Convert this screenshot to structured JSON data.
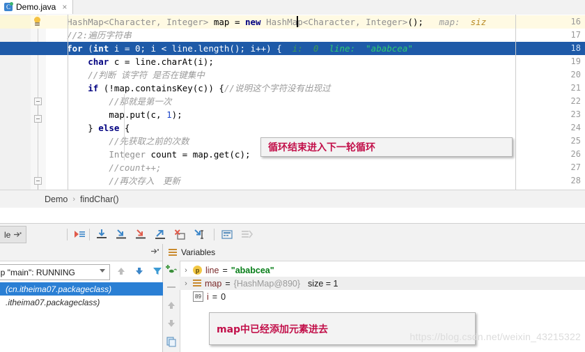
{
  "window": {
    "tab": {
      "title": "Demo.java",
      "icon": "java-class-icon",
      "close": "×"
    }
  },
  "editor": {
    "lines": [
      {
        "num": "16",
        "state": "current",
        "indent": 8,
        "tokens": [
          {
            "t": "plain",
            "v": "    "
          },
          {
            "t": "gen",
            "v": "HashMap<Character, Integer>"
          },
          {
            "t": "plain",
            "v": " map = "
          },
          {
            "t": "kw",
            "v": "new"
          },
          {
            "t": "plain",
            "v": " "
          },
          {
            "t": "gen",
            "v": "HashMap<Character, Integer>"
          },
          {
            "t": "plain",
            "v": "();"
          }
        ],
        "inlay": "map:",
        "inlay_value": "siz"
      },
      {
        "num": "17",
        "state": "normal",
        "tokens": [
          {
            "t": "comment",
            "v": "    //2:遍历字符串"
          }
        ]
      },
      {
        "num": "18",
        "state": "selected",
        "tokens": [
          {
            "t": "plain",
            "v": "    "
          },
          {
            "t": "kw",
            "v": "for"
          },
          {
            "t": "plain",
            "v": " ("
          },
          {
            "t": "kw",
            "v": "int"
          },
          {
            "t": "plain",
            "v": " i = "
          },
          {
            "t": "num",
            "v": "0"
          },
          {
            "t": "plain",
            "v": "; i < line.length(); i++) {"
          }
        ],
        "hint_i": "i:  0",
        "hint_line": "line:  \"ababcea\""
      },
      {
        "num": "19",
        "state": "normal",
        "tokens": [
          {
            "t": "plain",
            "v": "        "
          },
          {
            "t": "kw",
            "v": "char"
          },
          {
            "t": "plain",
            "v": " c = line.charAt(i);"
          }
        ]
      },
      {
        "num": "20",
        "state": "normal",
        "tokens": [
          {
            "t": "comment",
            "v": "        //判断 该字符 是否在键集中"
          }
        ]
      },
      {
        "num": "21",
        "state": "normal",
        "tokens": [
          {
            "t": "plain",
            "v": "        "
          },
          {
            "t": "kw",
            "v": "if"
          },
          {
            "t": "plain",
            "v": " (!map.containsKey(c)) {"
          },
          {
            "t": "comment",
            "v": "//说明这个字符没有出现过"
          }
        ]
      },
      {
        "num": "22",
        "state": "normal",
        "tokens": [
          {
            "t": "comment",
            "v": "            //那就是第一次"
          }
        ]
      },
      {
        "num": "23",
        "state": "normal",
        "tokens": [
          {
            "t": "plain",
            "v": "            map.put(c, "
          },
          {
            "t": "num",
            "v": "1"
          },
          {
            "t": "plain",
            "v": ");"
          }
        ]
      },
      {
        "num": "24",
        "state": "normal",
        "tokens": [
          {
            "t": "plain",
            "v": "        } "
          },
          {
            "t": "kw",
            "v": "else"
          },
          {
            "t": "plain",
            "v": " {"
          }
        ]
      },
      {
        "num": "25",
        "state": "normal",
        "tokens": [
          {
            "t": "comment",
            "v": "            //先获取之前的次数"
          }
        ]
      },
      {
        "num": "26",
        "state": "normal",
        "tokens": [
          {
            "t": "plain",
            "v": "            "
          },
          {
            "t": "gen",
            "v": "Integer"
          },
          {
            "t": "plain",
            "v": " count = map.get(c);"
          }
        ]
      },
      {
        "num": "27",
        "state": "normal",
        "tokens": [
          {
            "t": "comment",
            "v": "            //count++;"
          }
        ]
      },
      {
        "num": "28",
        "state": "normal",
        "tokens": [
          {
            "t": "comment",
            "v": "            //再次存入　更新"
          }
        ]
      }
    ]
  },
  "annotations": {
    "code_note": "循环结束进入下一轮循环",
    "vars_note": "map中已经添加元素进去"
  },
  "breadcrumb": {
    "items": [
      "Demo",
      "findChar()"
    ],
    "separator": "›"
  },
  "debug_toolbar": {
    "tab_label": "le",
    "buttons": [
      {
        "name": "resume-program",
        "title": "Resume Program"
      },
      {
        "name": "step-over",
        "title": "Step Over"
      },
      {
        "name": "step-into",
        "title": "Step Into"
      },
      {
        "name": "force-step-into",
        "title": "Force Step Into"
      },
      {
        "name": "step-out",
        "title": "Step Out"
      },
      {
        "name": "drop-frame",
        "title": "Drop Frame"
      },
      {
        "name": "run-to-cursor",
        "title": "Run to Cursor"
      },
      {
        "name": "evaluate-expression",
        "title": "Evaluate Expression"
      },
      {
        "name": "show-execution-point",
        "title": "Show Execution Point"
      }
    ]
  },
  "frames": {
    "thread_selector": "up \"main\": RUNNING",
    "rows": [
      {
        "text": "(cn.itheima07.packageclass)",
        "selected": true
      },
      {
        "text": ".itheima07.packageclass)",
        "selected": false
      }
    ],
    "nav": {
      "up": "↑",
      "down": "↓",
      "filter": "filter-icon"
    }
  },
  "variables": {
    "title": "Variables",
    "rows": [
      {
        "chevron": "›",
        "icon": "parameter-icon",
        "icon_label": "p",
        "name": "line",
        "eq": " = ",
        "value": "\"ababcea\"",
        "value_kind": "string",
        "shaded": false
      },
      {
        "chevron": "›",
        "icon": "object-icon",
        "icon_label": "",
        "name": "map",
        "eq": " = ",
        "value": "{HashMap@890}",
        "extra": "size = 1",
        "value_kind": "ref",
        "shaded": true
      },
      {
        "chevron": "",
        "icon": "primitive-icon",
        "icon_label": "89",
        "name": "i",
        "eq": " = ",
        "value": "0",
        "value_kind": "number",
        "shaded": false
      }
    ],
    "tools": [
      {
        "name": "add-watch-icon"
      },
      {
        "name": "remove-watch-icon"
      },
      {
        "name": "move-up-icon"
      },
      {
        "name": "move-down-icon"
      },
      {
        "name": "copy-value-icon"
      }
    ]
  },
  "watermark": "https://blog.csdn.net/weixin_43215322",
  "colors": {
    "selection": "#1e5aa8",
    "current_line": "#fffae3",
    "keyword": "#000080",
    "string": "#067d17",
    "comment": "#9a9a9a",
    "annotation_red": "#c2104a",
    "frame_selected": "#2a7fd4"
  }
}
